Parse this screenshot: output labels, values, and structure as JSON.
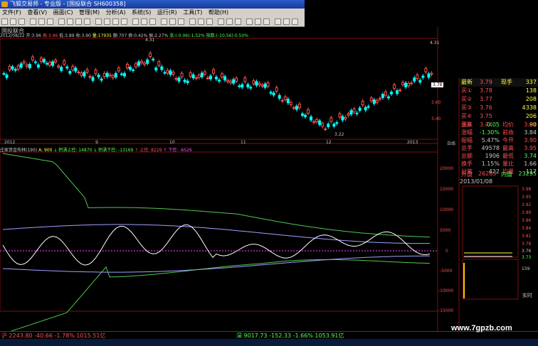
{
  "window": {
    "title": "飞狐交易师 - 专业版 - [国投联合 SH600358]"
  },
  "menu": [
    "文件(F)",
    "查看(V)",
    "画面(C)",
    "管理(M)",
    "分析(A)",
    "系统(S)",
    "运行(R)",
    "工具(T)",
    "帮助(H)"
  ],
  "stock_name": "国投联合",
  "info_line": {
    "date": "2012/08/22",
    "open": "开:3.96",
    "high": "高:3.96",
    "low": "低:3.89",
    "close": "收:3.90",
    "volume": "量:17935",
    "amount": "额:707",
    "turnover": "换:0.42%",
    "amplitude": "振:2.27%",
    "change": "涨:(-0.06)-1.52%",
    "index": "指数:(-10.56)-0.50%"
  },
  "indicator_line": {
    "name": "庄家资金布林(190)",
    "a": "A: 900",
    "upper": "↓ 积涌上控: 14870",
    "lower": "↓ 积涌下控: -13169",
    "up_ctl": "↑ 上控: 8229",
    "down_ctl": "↑ 下控: -6526"
  },
  "price_chart": {
    "high_mark": "4.31",
    "low_mark": "3.22",
    "axis": [
      "3.60",
      "3.40"
    ],
    "current": "3.78",
    "time_labels": [
      "2012",
      "9",
      "10",
      "11",
      "12",
      "2013"
    ],
    "day_label": "日线"
  },
  "indicator_axis": [
    "20000",
    "15000",
    "10000",
    "5000",
    "0",
    "-5000",
    "-10000",
    "-15000"
  ],
  "quote_panel": {
    "header": {
      "label": "最新",
      "price": "3.79",
      "extra": "现手",
      "vol": "337"
    },
    "asks": [
      {
        "label": "买①",
        "price": "3.78",
        "vol": "138"
      },
      {
        "label": "买②",
        "price": "3.77",
        "vol": "208"
      },
      {
        "label": "买③",
        "price": "3.76",
        "vol": "4338"
      },
      {
        "label": "买④",
        "price": "3.75",
        "vol": "206"
      },
      {
        "label": "买⑤",
        "price": "3.74",
        "vol": "90"
      }
    ],
    "stats": [
      {
        "l1": "涨跌",
        "v1": "-0.05",
        "l2": "均价",
        "v2": "3.84"
      },
      {
        "l1": "涨幅",
        "v1": "-1.30%",
        "l2": "前收",
        "v2": "3.84"
      },
      {
        "l1": "振幅",
        "v1": "5.47%",
        "l2": "今开",
        "v2": "3.90"
      },
      {
        "l1": "总手",
        "v1": "49578",
        "l2": "最高",
        "v2": "3.95"
      },
      {
        "l1": "总额",
        "v1": "1906",
        "l2": "最低",
        "v2": "3.74"
      },
      {
        "l1": "换手",
        "v1": "1.15%",
        "l2": "量比",
        "v2": "1.66"
      },
      {
        "l1": "分笔",
        "v1": "422",
        "l2": "均量",
        "v2": "117"
      }
    ],
    "outer": {
      "label": "外盘",
      "value": "26283",
      "label2": "内盘",
      "value2": "23295"
    },
    "date": "2013/01/08",
    "mini_axis": [
      "3.98",
      "3.95",
      "3.92",
      "3.89",
      "3.86",
      "3.84",
      "3.81",
      "3.78",
      "3.76",
      "3.73"
    ],
    "vol_label": "159",
    "realtime": "实时"
  },
  "bottom": {
    "sh": "沪 2243.80 -40.66 -1.78% 1015.51亿",
    "sz": "深 9017.73 -152.33 -1.66% 1053.91亿"
  },
  "watermark": "www.7gpzb.com",
  "colors": {
    "up": "#ff5050",
    "down": "#00ffff",
    "band_outer": "#50c850",
    "band_inner": "#a0a0ff",
    "indicator": "#ffffff",
    "zero": "#ff50ff"
  }
}
